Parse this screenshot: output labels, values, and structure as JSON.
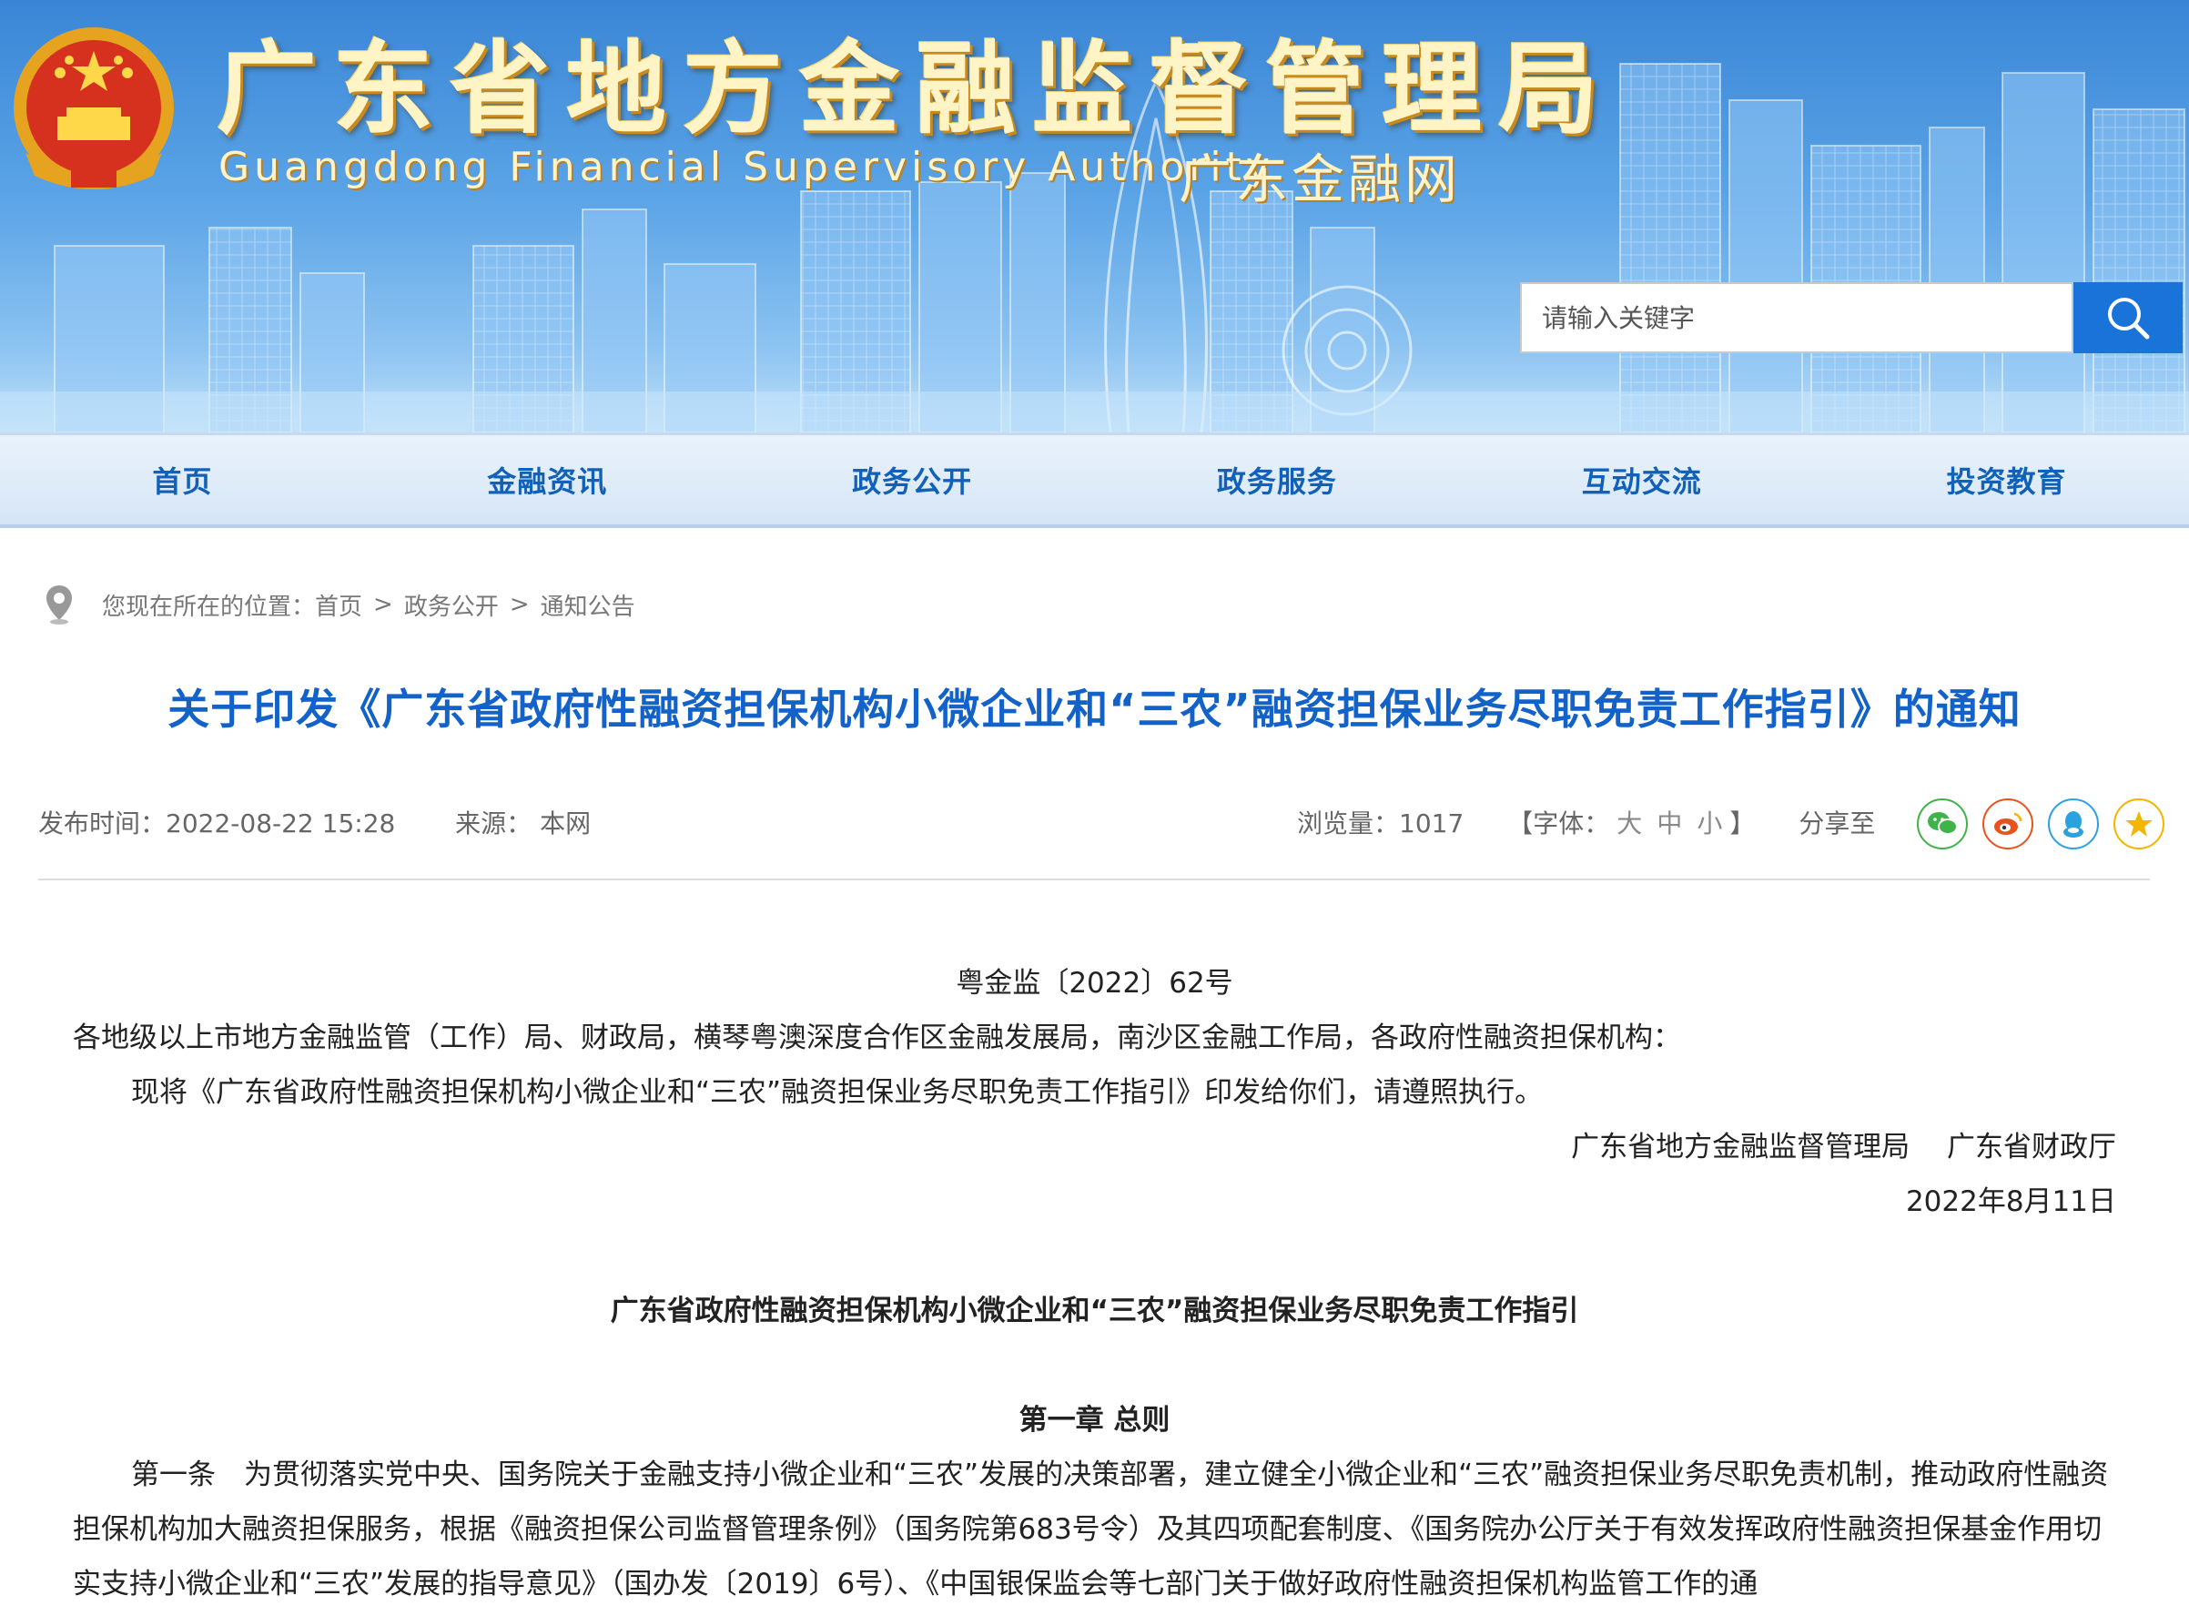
{
  "header": {
    "title": "广东省地方金融监督管理局",
    "subtitle_en": "Guangdong Financial Supervisory Authority",
    "subtitle_cn": "广东金融网",
    "search_placeholder": "请输入关键字"
  },
  "nav": [
    "首页",
    "金融资讯",
    "政务公开",
    "政务服务",
    "互动交流",
    "投资教育"
  ],
  "breadcrumb": {
    "prefix": "您现在所在的位置：",
    "items": [
      "首页",
      "政务公开",
      "通知公告"
    ],
    "separator": ">"
  },
  "article": {
    "title": "关于印发《广东省政府性融资担保机构小微企业和“三农”融资担保业务尽职免责工作指引》的通知",
    "publish_label": "发布时间：",
    "publish_time": "2022-08-22 15:28",
    "source_label": "来源：",
    "source": "本网",
    "views_label": "浏览量：",
    "views": "1017",
    "font_label_open": "【字体：",
    "font_sizes": [
      "大",
      "中",
      "小"
    ],
    "font_label_close": "】",
    "share_label": "分享至",
    "doc_number": "粤金监〔2022〕62号",
    "recipients": "各地级以上市地方金融监管（工作）局、财政局，横琴粤澳深度合作区金融发展局，南沙区金融工作局，各政府性融资担保机构：",
    "body": "现将《广东省政府性融资担保机构小微企业和“三农”融资担保业务尽职免责工作指引》印发给你们，请遵照执行。",
    "signers": "广东省地方金融监督管理局　 广东省财政厅",
    "date": "2022年8月11日",
    "guide_title": "广东省政府性融资担保机构小微企业和“三农”融资担保业务尽职免责工作指引",
    "chapter_title": "第一章 总则",
    "article_one": "第一条　为贯彻落实党中央、国务院关于金融支持小微企业和“三农”发展的决策部署，建立健全小微企业和“三农”融资担保业务尽职免责机制，推动政府性融资担保机构加大融资担保服务，根据《融资担保公司监督管理条例》（国务院第683号令）及其四项配套制度、《国务院办公厅关于有效发挥政府性融资担保基金作用切实支持小微企业和“三农”发展的指导意见》（国办发〔2019〕6号）、《中国银保监会等七部门关于做好政府性融资担保机构监管工作的通"
  },
  "colors": {
    "nav_text": "#1261b8",
    "title_text": "#1262c9",
    "search_button": "#1a73d8",
    "wechat": "#3fb24a",
    "weibo": "#e8531d",
    "qq": "#2aa2e0",
    "qzone": "#f4b400"
  },
  "icons": [
    "emblem-icon",
    "search-icon",
    "location-pin-icon",
    "wechat-icon",
    "weibo-icon",
    "qq-icon",
    "qzone-icon"
  ]
}
